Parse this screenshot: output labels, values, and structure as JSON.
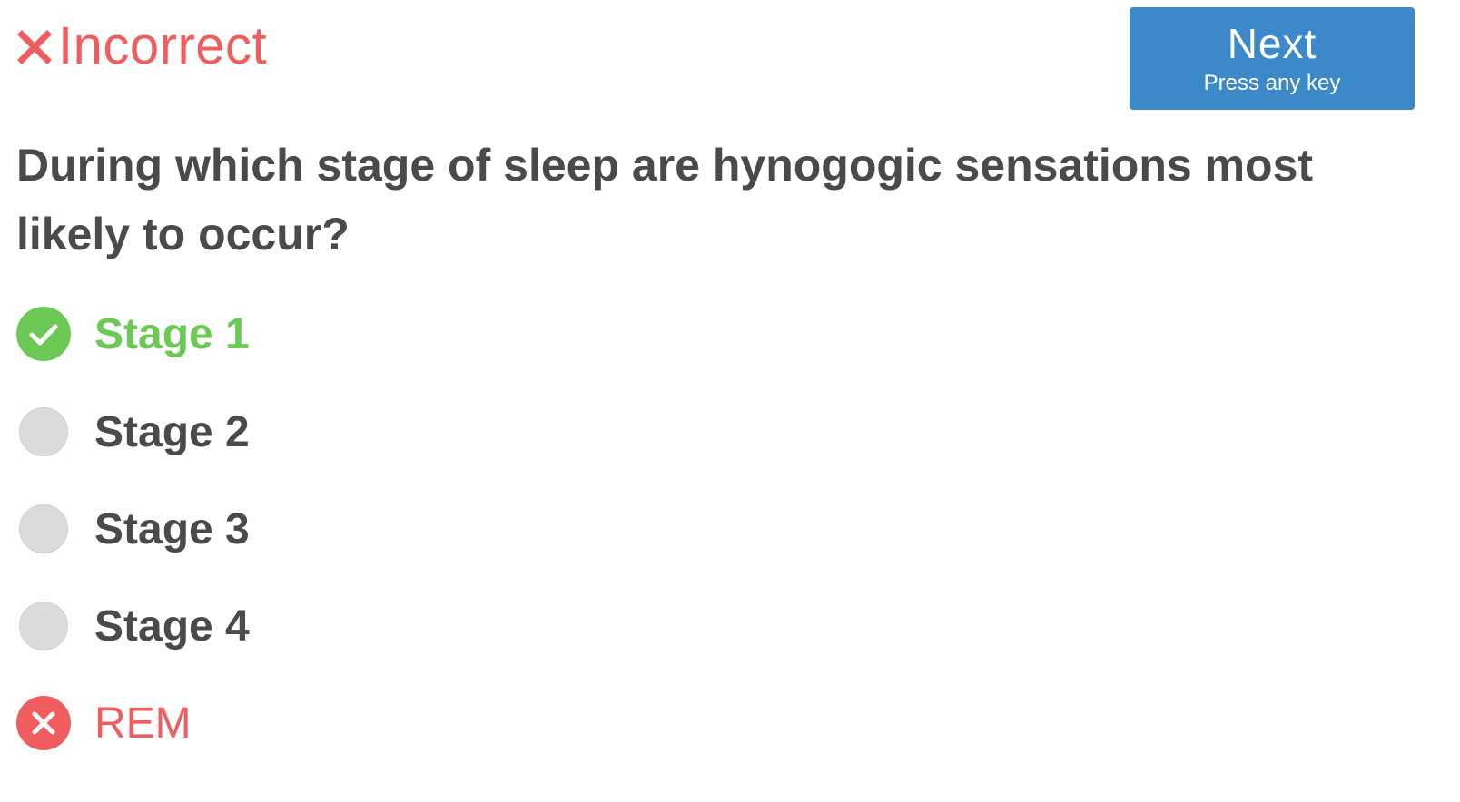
{
  "result": {
    "status_label": "Incorrect",
    "icon": "x-icon",
    "color": "#f05d5e"
  },
  "next_button": {
    "label": "Next",
    "hint": "Press any key",
    "color": "#3d88c9"
  },
  "question": {
    "text": "During which stage of sleep are hynogogic sensations most likely to occur?"
  },
  "options": [
    {
      "label": "Stage 1",
      "state": "correct",
      "icon": "check-circle-icon",
      "color": "#6cc955"
    },
    {
      "label": "Stage 2",
      "state": "unselected",
      "icon": "radio-empty-icon"
    },
    {
      "label": "Stage 3",
      "state": "unselected",
      "icon": "radio-empty-icon"
    },
    {
      "label": "Stage 4",
      "state": "unselected",
      "icon": "radio-empty-icon"
    },
    {
      "label": "REM",
      "state": "selected-wrong",
      "icon": "x-circle-icon",
      "color": "#f05d5e"
    }
  ]
}
